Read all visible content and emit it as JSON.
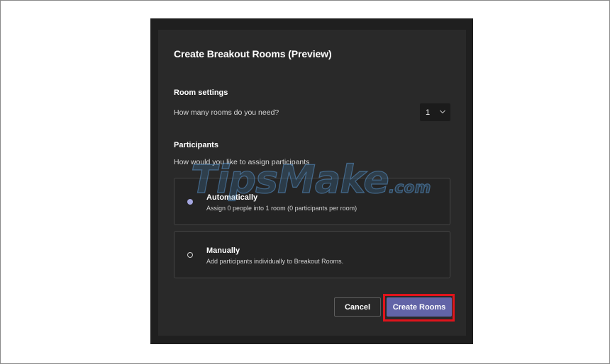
{
  "dialog": {
    "title": "Create Breakout Rooms (Preview)"
  },
  "room_settings": {
    "heading": "Room settings",
    "question": "How many rooms do you need?",
    "selected_count": "1"
  },
  "participants": {
    "heading": "Participants",
    "question": "How would you like to assign participants",
    "options": [
      {
        "title": "Automatically",
        "description": "Assign 0 people into 1 room (0 participants per room)",
        "selected": true
      },
      {
        "title": "Manually",
        "description": "Add participants individually to Breakout Rooms.",
        "selected": false
      }
    ]
  },
  "buttons": {
    "cancel_label": "Cancel",
    "create_label": "Create Rooms"
  },
  "watermark": {
    "text": "TipsMake",
    "suffix": ".com"
  },
  "colors": {
    "accent": "#6264a7",
    "radio_selected": "#a4a6e0",
    "highlight_box": "#e0141c",
    "dialog_bg": "#292929"
  }
}
